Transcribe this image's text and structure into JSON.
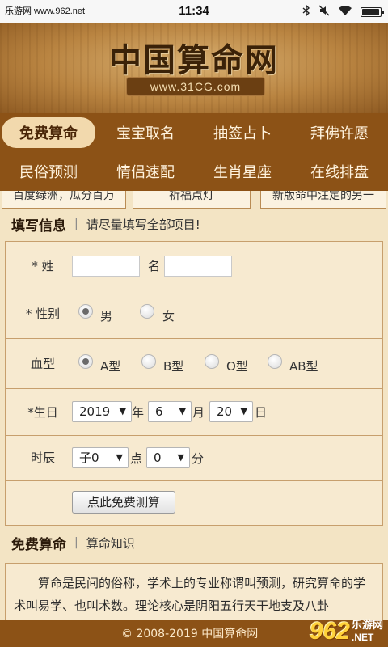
{
  "status_bar": {
    "watermark_text": "乐游网 www.962.net",
    "time": "11:34",
    "battery_level": 0.95
  },
  "header": {
    "title": "中国算命网",
    "url": "www.31CG.com"
  },
  "nav": {
    "items": [
      {
        "label": "免费算命",
        "active": true
      },
      {
        "label": "宝宝取名",
        "active": false
      },
      {
        "label": "抽签占卜",
        "active": false
      },
      {
        "label": "拜佛许愿",
        "active": false
      },
      {
        "label": "民俗预测",
        "active": false
      },
      {
        "label": "情侣速配",
        "active": false
      },
      {
        "label": "生肖星座",
        "active": false
      },
      {
        "label": "在线排盘",
        "active": false
      }
    ]
  },
  "promo": {
    "items": [
      "百度绿洲，瓜分百万",
      "祈福点灯",
      "新版命中注定的另一"
    ]
  },
  "form_section": {
    "title": "填写信息",
    "subtitle": "请尽量填写全部项目!"
  },
  "form": {
    "surname_label": "* 姓",
    "surname_value": "",
    "given_name_label": "名",
    "given_name_value": "",
    "gender_label": "* 性别",
    "gender_options": [
      "男",
      "女"
    ],
    "gender_selected": "男",
    "blood_label": "血型",
    "blood_options": [
      "A型",
      "B型",
      "O型",
      "AB型"
    ],
    "blood_selected": "A型",
    "birthday_label": "*生日",
    "year_value": "2019",
    "year_unit": "年",
    "month_value": "6",
    "month_unit": "月",
    "day_value": "20",
    "day_unit": "日",
    "hour_label": "时辰",
    "hour_value": "子0",
    "hour_unit": "点",
    "minute_value": "0",
    "minute_unit": "分",
    "submit_label": "点此免费测算"
  },
  "article_section": {
    "title": "免费算命",
    "subtitle": "算命知识",
    "text": "算命是民间的俗称，学术上的专业称谓叫预测，研究算命的学术叫易学、也叫术数。理论核心是阴阳五行天干地支及八卦"
  },
  "footer": {
    "copyright": "© 2008-2019 中国算命网",
    "watermark_logo": "962",
    "watermark_cn": "乐游网",
    "watermark_net": ".NET"
  },
  "colors": {
    "nav_bg": "#8c5216",
    "page_bg": "#f3e4c4",
    "active_pill": "#f2d9ad"
  }
}
